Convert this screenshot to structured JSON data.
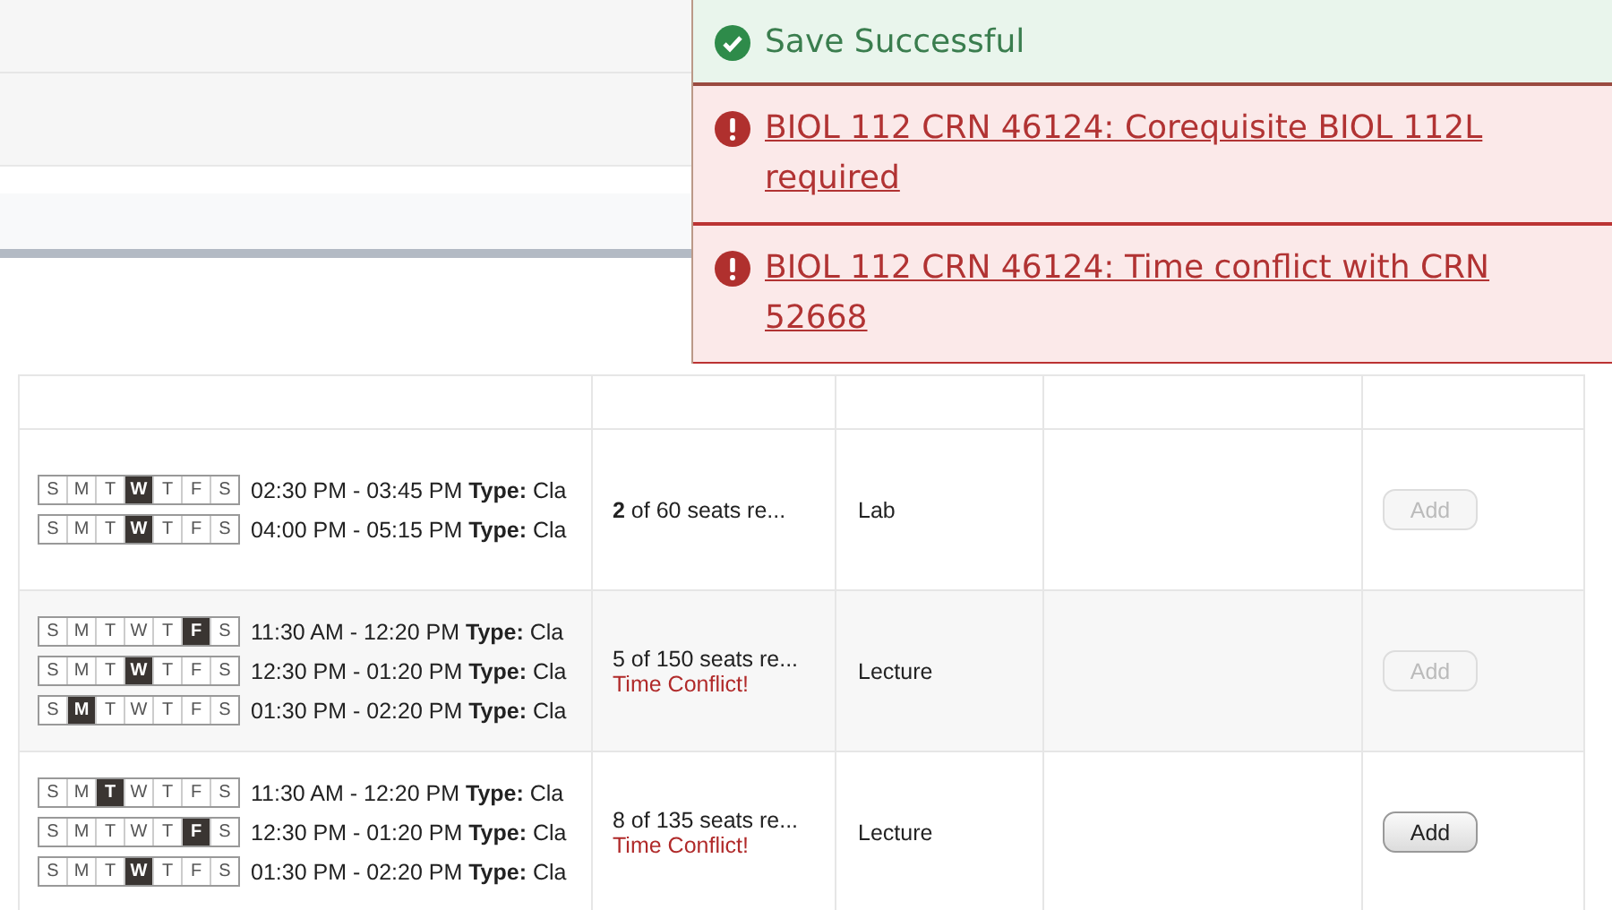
{
  "notifications": [
    {
      "kind": "success",
      "text": "Save Successful"
    },
    {
      "kind": "error",
      "text": "BIOL 112 CRN 46124: Corequisite BIOL 112L required"
    },
    {
      "kind": "error",
      "text": "BIOL 112 CRN 46124: Time conflict with CRN 52668"
    }
  ],
  "rows": [
    {
      "meetings": [
        {
          "days": [
            {
              "label": "S",
              "selected": false
            },
            {
              "label": "M",
              "selected": false
            },
            {
              "label": "T",
              "selected": false
            },
            {
              "label": "W",
              "selected": true
            },
            {
              "label": "T",
              "selected": false
            },
            {
              "label": "F",
              "selected": false
            },
            {
              "label": "S",
              "selected": false
            }
          ],
          "text": "02:30 PM - 03:45 PM **Type:** Cla"
        },
        {
          "days": [
            {
              "label": "S",
              "selected": false
            },
            {
              "label": "M",
              "selected": false
            },
            {
              "label": "T",
              "selected": false
            },
            {
              "label": "W",
              "selected": true
            },
            {
              "label": "T",
              "selected": false
            },
            {
              "label": "F",
              "selected": false
            },
            {
              "label": "S",
              "selected": false
            }
          ],
          "text": "04:00 PM - 05:15 PM **Type:** Cla"
        }
      ],
      "seats": "**2** of 60 seats re...",
      "type": "Lab",
      "button": {
        "label": "Add",
        "disabled": true
      }
    },
    {
      "meetings": [
        {
          "days": [
            {
              "label": "S",
              "selected": false
            },
            {
              "label": "M",
              "selected": false
            },
            {
              "label": "T",
              "selected": false
            },
            {
              "label": "W",
              "selected": false
            },
            {
              "label": "T",
              "selected": false
            },
            {
              "label": "F",
              "selected": true
            },
            {
              "label": "S",
              "selected": false
            }
          ],
          "text": "11:30 AM - 12:20 PM **Type:** Cla"
        },
        {
          "days": [
            {
              "label": "S",
              "selected": false
            },
            {
              "label": "M",
              "selected": false
            },
            {
              "label": "T",
              "selected": false
            },
            {
              "label": "W",
              "selected": true
            },
            {
              "label": "T",
              "selected": false
            },
            {
              "label": "F",
              "selected": false
            },
            {
              "label": "S",
              "selected": false
            }
          ],
          "text": "12:30 PM - 01:20 PM **Type:** Cla"
        },
        {
          "days": [
            {
              "label": "S",
              "selected": false
            },
            {
              "label": "M",
              "selected": true
            },
            {
              "label": "T",
              "selected": false
            },
            {
              "label": "W",
              "selected": false
            },
            {
              "label": "T",
              "selected": false
            },
            {
              "label": "F",
              "selected": false
            },
            {
              "label": "S",
              "selected": false
            }
          ],
          "text": "01:30 PM - 02:20 PM **Type:** Cla"
        }
      ],
      "seats": "5 of 150 seats re...",
      "conflict_text": "Time Conflict!",
      "type": "Lecture",
      "button": {
        "label": "Add",
        "disabled": true
      }
    },
    {
      "meetings": [
        {
          "days": [
            {
              "label": "S",
              "selected": false
            },
            {
              "label": "M",
              "selected": false
            },
            {
              "label": "T",
              "selected": true
            },
            {
              "label": "W",
              "selected": false
            },
            {
              "label": "T",
              "selected": false
            },
            {
              "label": "F",
              "selected": false
            },
            {
              "label": "S",
              "selected": false
            }
          ],
          "text": "11:30 AM - 12:20 PM **Type:** Cla"
        },
        {
          "days": [
            {
              "label": "S",
              "selected": false
            },
            {
              "label": "M",
              "selected": false
            },
            {
              "label": "T",
              "selected": false
            },
            {
              "label": "W",
              "selected": false
            },
            {
              "label": "T",
              "selected": false
            },
            {
              "label": "F",
              "selected": true
            },
            {
              "label": "S",
              "selected": false
            }
          ],
          "text": "12:30 PM - 01:20 PM **Type:** Cla"
        },
        {
          "days": [
            {
              "label": "S",
              "selected": false
            },
            {
              "label": "M",
              "selected": false
            },
            {
              "label": "T",
              "selected": false
            },
            {
              "label": "W",
              "selected": true
            },
            {
              "label": "T",
              "selected": false
            },
            {
              "label": "F",
              "selected": false
            },
            {
              "label": "S",
              "selected": false
            }
          ],
          "text": "01:30 PM - 02:20 PM **Type:** Cla"
        }
      ],
      "seats": "8 of 135 seats re...",
      "conflict_text": "Time Conflict!",
      "type": "Lecture",
      "button": {
        "label": "Add",
        "disabled": false
      }
    }
  ]
}
